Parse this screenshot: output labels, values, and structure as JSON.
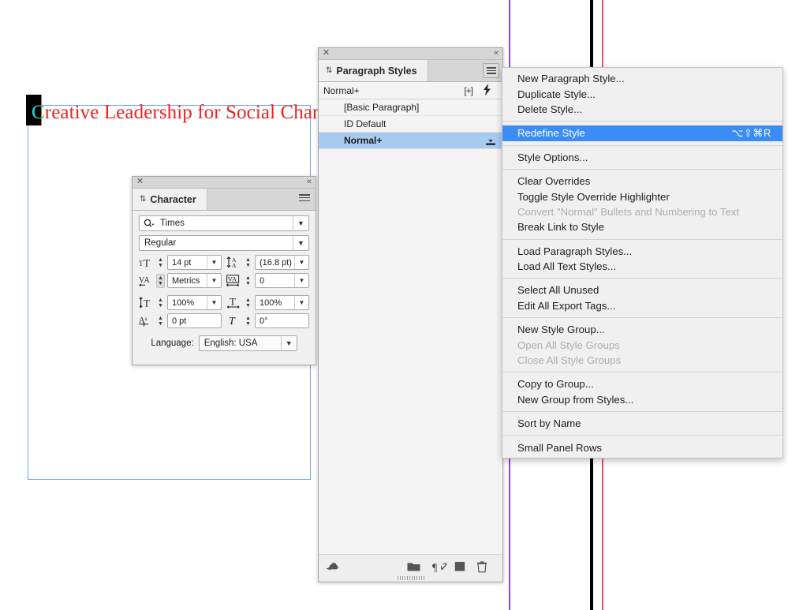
{
  "document": {
    "text": "Creative Leadership for Social Change",
    "first_char": "C",
    "text_color": "#ee2222",
    "selection_color": "#16d8d8",
    "frame_border_color": "#6aa8f0"
  },
  "guides": [
    {
      "name": "purple-guide",
      "color": "#9b3bf5"
    },
    {
      "name": "black-spine-guide",
      "color": "#000000"
    },
    {
      "name": "red-margin-guide",
      "color": "#f0555f"
    }
  ],
  "paragraph_styles_panel": {
    "close_glyph": "✕",
    "collapse_glyph": "«",
    "tab_grip_glyph": "⇅",
    "tab_label": "Paragraph Styles",
    "current_style": "Normal+",
    "plus_icon_label": "[+]",
    "bolt_icon_glyph": "⚡",
    "styles": [
      {
        "label": "[Basic Paragraph]",
        "selected": false,
        "has_icon": false
      },
      {
        "label": "ID Default",
        "selected": false,
        "has_icon": false
      },
      {
        "label": "Normal+",
        "selected": true,
        "has_icon": true
      }
    ],
    "footer_icons": [
      "cc-libraries-icon",
      "new-style-group-folder-icon",
      "clear-overrides-pilcrow-icon",
      "new-style-icon",
      "delete-style-trash-icon"
    ]
  },
  "character_panel": {
    "close_glyph": "✕",
    "collapse_glyph": "«",
    "tab_grip_glyph": "⇅",
    "tab_label": "Character",
    "font_family": "Times",
    "font_style": "Regular",
    "fields": [
      {
        "icon": "font-size-icon",
        "value": "14 pt",
        "dropdown": true,
        "spinner_dim": false
      },
      {
        "icon": "leading-icon",
        "value": "(16.8 pt)",
        "dropdown": true,
        "spinner_dim": false
      },
      {
        "icon": "kerning-icon",
        "value": "Metrics",
        "dropdown": true,
        "spinner_dim": true
      },
      {
        "icon": "tracking-icon",
        "value": "0",
        "dropdown": true,
        "spinner_dim": false
      },
      {
        "icon": "vertical-scale-icon",
        "value": "100%",
        "dropdown": true,
        "spinner_dim": false
      },
      {
        "icon": "horizontal-scale-icon",
        "value": "100%",
        "dropdown": true,
        "spinner_dim": false
      },
      {
        "icon": "baseline-shift-icon",
        "value": "0 pt",
        "dropdown": false,
        "spinner_dim": false
      },
      {
        "icon": "skew-icon",
        "value": "0°",
        "dropdown": false,
        "spinner_dim": false
      }
    ],
    "language_label": "Language:",
    "language_value": "English: USA"
  },
  "flyout_menu": {
    "highlight_color": "#3b8cf5",
    "items": [
      {
        "label": "New Paragraph Style...",
        "type": "item"
      },
      {
        "label": "Duplicate Style...",
        "type": "item"
      },
      {
        "label": "Delete Style...",
        "type": "item"
      },
      {
        "type": "separator"
      },
      {
        "label": "Redefine Style",
        "type": "item",
        "highlighted": true,
        "shortcut": "⌥⇧⌘R"
      },
      {
        "type": "separator"
      },
      {
        "label": "Style Options...",
        "type": "item"
      },
      {
        "type": "separator"
      },
      {
        "label": "Clear Overrides",
        "type": "item"
      },
      {
        "label": "Toggle Style Override Highlighter",
        "type": "item"
      },
      {
        "label": "Convert \"Normal\" Bullets and Numbering to Text",
        "type": "item",
        "disabled": true
      },
      {
        "label": "Break Link to Style",
        "type": "item"
      },
      {
        "type": "separator"
      },
      {
        "label": "Load Paragraph Styles...",
        "type": "item"
      },
      {
        "label": "Load All Text Styles...",
        "type": "item"
      },
      {
        "type": "separator"
      },
      {
        "label": "Select All Unused",
        "type": "item"
      },
      {
        "label": "Edit All Export Tags...",
        "type": "item"
      },
      {
        "type": "separator"
      },
      {
        "label": "New Style Group...",
        "type": "item"
      },
      {
        "label": "Open All Style Groups",
        "type": "item",
        "disabled": true
      },
      {
        "label": "Close All Style Groups",
        "type": "item",
        "disabled": true
      },
      {
        "type": "separator"
      },
      {
        "label": "Copy to Group...",
        "type": "item"
      },
      {
        "label": "New Group from Styles...",
        "type": "item"
      },
      {
        "type": "separator"
      },
      {
        "label": "Sort by Name",
        "type": "item"
      },
      {
        "type": "separator"
      },
      {
        "label": "Small Panel Rows",
        "type": "item"
      }
    ]
  }
}
